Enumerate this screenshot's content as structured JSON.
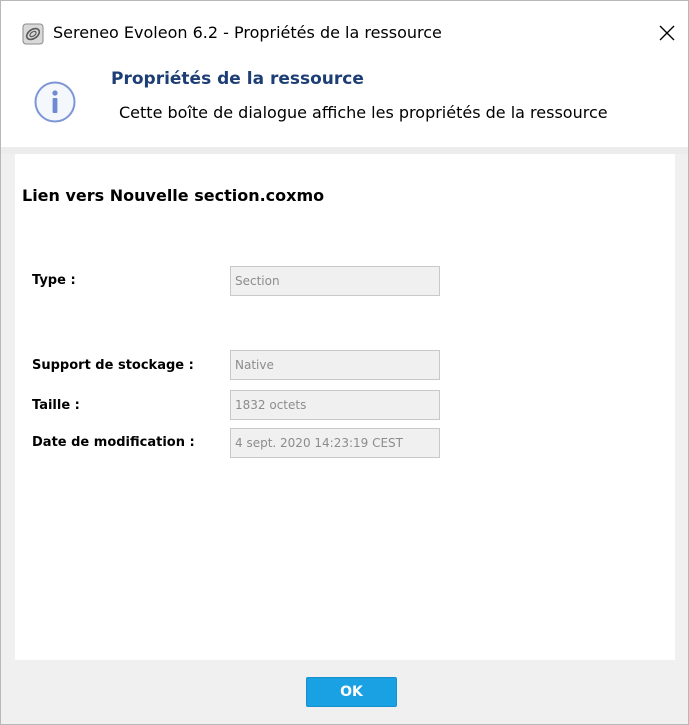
{
  "window": {
    "title": "Sereneo Evoleon 6.2 - Propriétés de la ressource",
    "close_icon": "close-icon",
    "app_icon": "app-logo-icon"
  },
  "header": {
    "icon": "info-icon",
    "title": "Propriétés de la ressource",
    "subtitle": "Cette boîte de dialogue affiche les propriétés de la ressource",
    "title_color": "#1d3e74"
  },
  "resource": {
    "name": "Lien vers Nouvelle section.coxmo"
  },
  "fields": [
    {
      "label": "Type :",
      "value": "Section"
    },
    {
      "label": "Support de stockage :",
      "value": "Native"
    },
    {
      "label": "Taille :",
      "value": "1832 octets"
    },
    {
      "label": "Date de modification :",
      "value": "4 sept. 2020 14:23:19 CEST"
    }
  ],
  "footer": {
    "ok_label": "OK",
    "ok_color": "#1aa1e4"
  }
}
